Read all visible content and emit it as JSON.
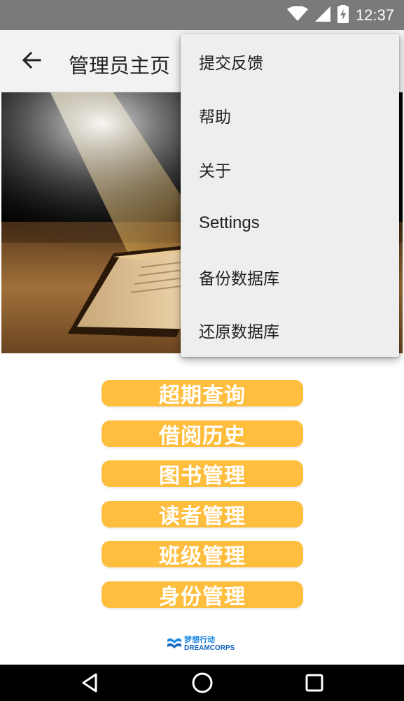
{
  "status_bar": {
    "time": "12:37",
    "icons": [
      "wifi-icon",
      "signal-icon",
      "battery-charging-icon"
    ]
  },
  "app_bar": {
    "title": "管理员主页",
    "back_icon": "arrow-back-icon"
  },
  "main_buttons": [
    {
      "label": "超期查询"
    },
    {
      "label": "借阅历史"
    },
    {
      "label": "图书管理"
    },
    {
      "label": "读者管理"
    },
    {
      "label": "班级管理"
    },
    {
      "label": "身份管理"
    }
  ],
  "logo": {
    "cn": "梦想行动",
    "en": "DREAMCORPS"
  },
  "overflow_menu": {
    "items": [
      {
        "label": "提交反馈"
      },
      {
        "label": "帮助"
      },
      {
        "label": "关于"
      },
      {
        "label": "Settings"
      },
      {
        "label": "备份数据库"
      },
      {
        "label": "还原数据库"
      }
    ]
  },
  "nav_bar": {
    "buttons": [
      "back-triangle-icon",
      "home-circle-icon",
      "recents-square-icon"
    ]
  },
  "colors": {
    "status_bar": "#7a7a7a",
    "app_bar": "#f2f2f2",
    "button": "#ffbe3e",
    "menu_bg": "#eeeeee",
    "logo_blue": "#1e88e5"
  }
}
